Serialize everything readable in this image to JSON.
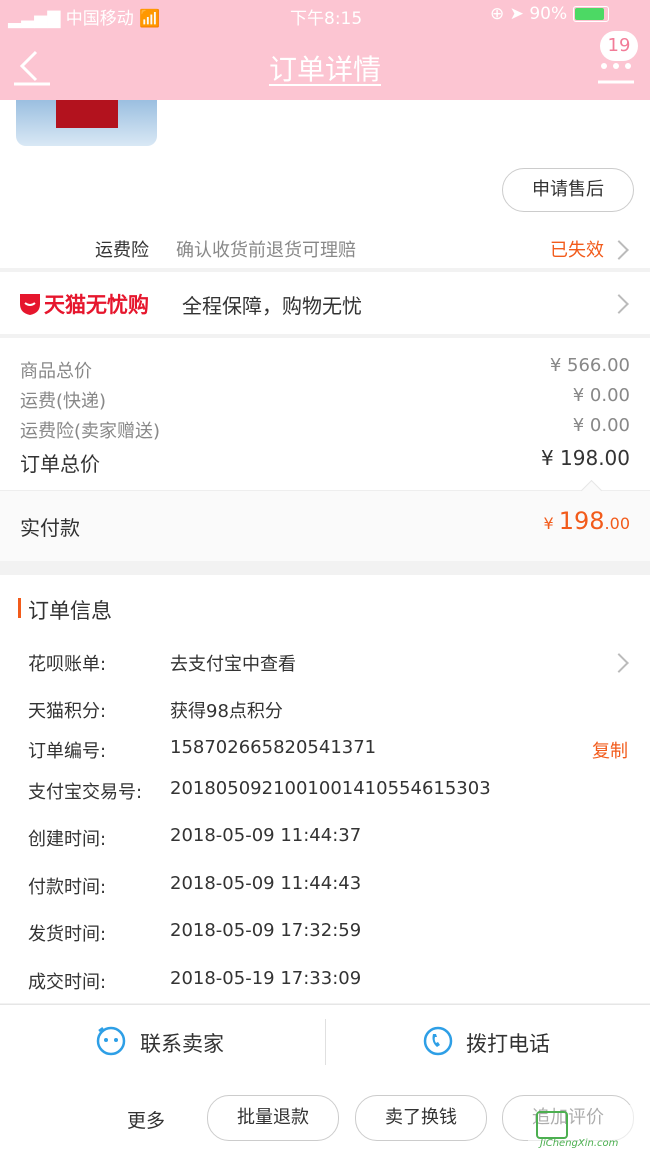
{
  "status_bar": {
    "carrier": "中国移动",
    "time": "下午8:15",
    "battery": "90%"
  },
  "nav": {
    "title": "订单详情",
    "badge_count": "19"
  },
  "after_sale": {
    "label": "申请售后"
  },
  "shipping_insurance": {
    "label": "运费险",
    "desc": "确认收货前退货可理赔",
    "status": "已失效"
  },
  "tmall_guarantee": {
    "brand": "天猫无忧购",
    "desc": "全程保障，购物无忧"
  },
  "price": {
    "rows": [
      {
        "label": "商品总价",
        "value": "¥ 566.00"
      },
      {
        "label": "运费(快递)",
        "value": "¥ 0.00"
      },
      {
        "label": "运费险(卖家赠送)",
        "value": "¥ 0.00"
      }
    ],
    "total_label": "订单总价",
    "total_value": "¥ 198.00",
    "paid_label": "实付款",
    "paid_currency": "¥",
    "paid_int": "198",
    "paid_dec": ".00"
  },
  "order_info": {
    "section_title": "订单信息",
    "huabei": {
      "label": "花呗账单:",
      "value": "去支付宝中查看"
    },
    "points": {
      "label": "天猫积分:",
      "value": "获得98点积分"
    },
    "order_no": {
      "label": "订单编号:",
      "value": "158702665820541371",
      "copy": "复制"
    },
    "alipay_no": {
      "label": "支付宝交易号:",
      "value": "2018050921001001410554615303"
    },
    "created": {
      "label": "创建时间:",
      "value": "2018-05-09 11:44:37"
    },
    "paid": {
      "label": "付款时间:",
      "value": "2018-05-09 11:44:43"
    },
    "shipped": {
      "label": "发货时间:",
      "value": "2018-05-09 17:32:59"
    },
    "completed": {
      "label": "成交时间:",
      "value": "2018-05-19 17:33:09"
    }
  },
  "contact": {
    "seller": "联系卖家",
    "phone": "拨打电话"
  },
  "bottom_bar": {
    "more": "更多",
    "batch_refund": "批量退款",
    "sell": "卖了换钱",
    "review": "追加评价"
  },
  "watermark": {
    "text": "JiChengXin.com"
  },
  "colors": {
    "header": "#fcc5d2",
    "accent": "#f25b1b",
    "tmall_red": "#e6162d"
  }
}
